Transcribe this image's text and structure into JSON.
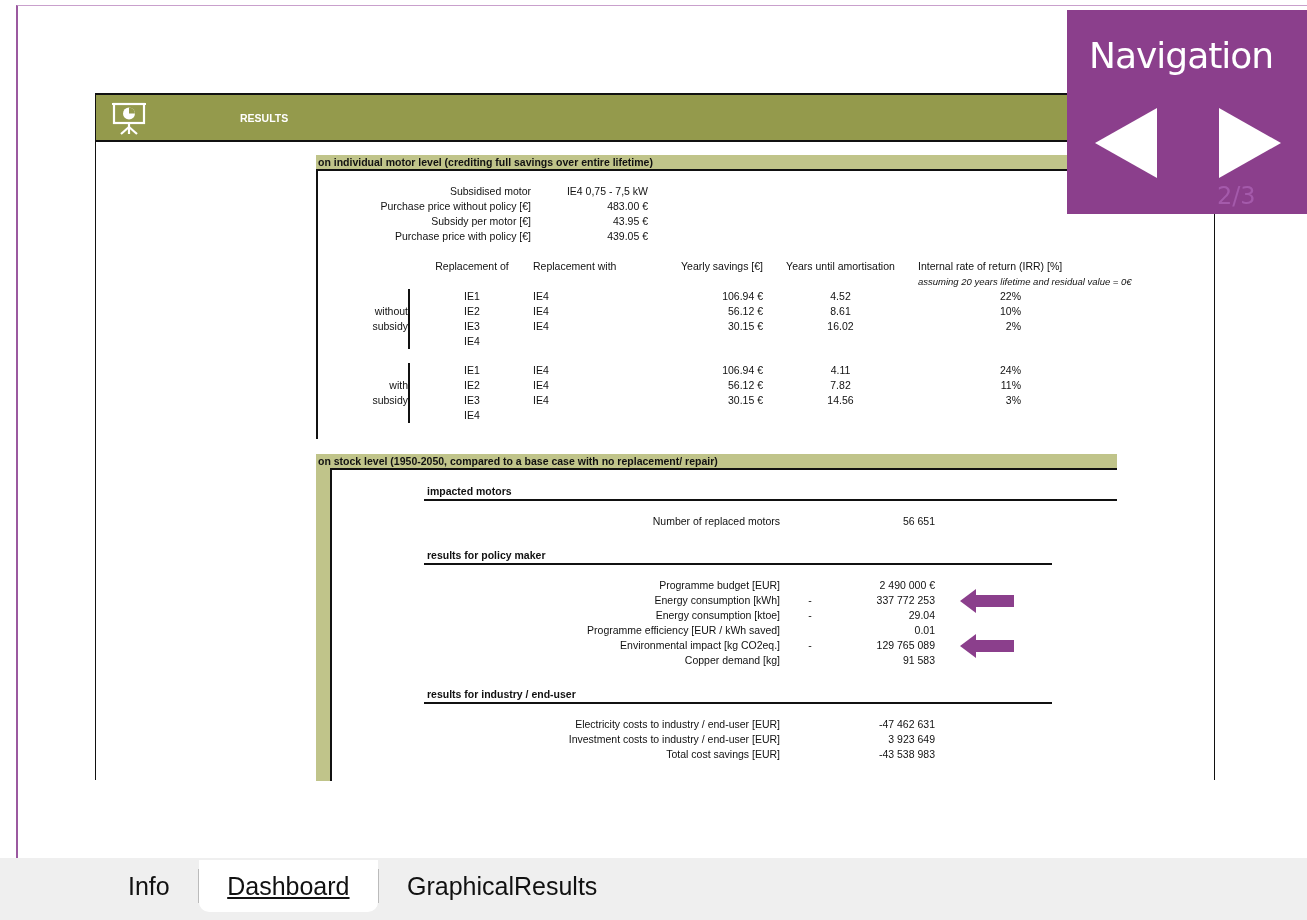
{
  "sheet_title": "RESULTS",
  "motor_section": {
    "title": "on individual motor level (crediting full savings over entire lifetime)",
    "parameters": [
      {
        "label": "Subsidised motor",
        "value": "IE4 0,75 - 7,5 kW"
      },
      {
        "label": "Purchase price without policy [€]",
        "value": "483.00 €"
      },
      {
        "label": "Subsidy per motor [€]",
        "value": "43.95 €"
      },
      {
        "label": "Purchase price with policy [€]",
        "value": "439.05 €"
      }
    ],
    "columns": [
      "Replacement of",
      "Replacement with",
      "Yearly savings [€]",
      "Years until amortisation",
      "Internal rate of return (IRR) [%]"
    ],
    "note": "assuming 20 years lifetime and residual value = 0€",
    "groups": [
      {
        "label_lines": [
          "without",
          "subsidy"
        ],
        "rows": [
          {
            "replacement_of": "IE1",
            "replacement_with": "IE4",
            "yearly_savings": "106.94 €",
            "years": "4.52",
            "irr": "22%"
          },
          {
            "replacement_of": "IE2",
            "replacement_with": "IE4",
            "yearly_savings": "56.12 €",
            "years": "8.61",
            "irr": "10%"
          },
          {
            "replacement_of": "IE3",
            "replacement_with": "IE4",
            "yearly_savings": "30.15 €",
            "years": "16.02",
            "irr": "2%"
          },
          {
            "replacement_of": "IE4"
          }
        ]
      },
      {
        "label_lines": [
          "with",
          "subsidy"
        ],
        "rows": [
          {
            "replacement_of": "IE1",
            "replacement_with": "IE4",
            "yearly_savings": "106.94 €",
            "years": "4.11",
            "irr": "24%"
          },
          {
            "replacement_of": "IE2",
            "replacement_with": "IE4",
            "yearly_savings": "56.12 €",
            "years": "7.82",
            "irr": "11%"
          },
          {
            "replacement_of": "IE3",
            "replacement_with": "IE4",
            "yearly_savings": "30.15 €",
            "years": "14.56",
            "irr": "3%"
          },
          {
            "replacement_of": "IE4"
          }
        ]
      }
    ]
  },
  "stock_section": {
    "title": "on stock level (1950-2050, compared to a base case with no replacement/ repair)",
    "blocks": [
      {
        "heading": "impacted motors",
        "rows": [
          {
            "label": "Number of replaced motors",
            "value": "56 651",
            "highlighted": false
          }
        ]
      },
      {
        "heading": "results for policy maker",
        "rows": [
          {
            "label": "Programme budget [EUR]",
            "value": "2 490 000 €",
            "highlighted": false
          },
          {
            "label": "Energy consumption [kWh]",
            "sign": "-",
            "value": "337 772 253",
            "highlighted": true
          },
          {
            "label": "Energy consumption [ktoe]",
            "sign": "-",
            "value": "29.04",
            "highlighted": false
          },
          {
            "label": "Programme efficiency [EUR / kWh saved]",
            "value": "0.01",
            "highlighted": false
          },
          {
            "label": "Environmental impact [kg CO2eq.]",
            "sign": "-",
            "value": "129 765 089",
            "highlighted": true
          },
          {
            "label": "Copper demand [kg]",
            "value": "91 583",
            "highlighted": false
          }
        ]
      },
      {
        "heading": "results for industry / end-user",
        "rows": [
          {
            "label": "Electricity costs to industry / end-user [EUR]",
            "value": "-47 462 631",
            "highlighted": false
          },
          {
            "label": "Investment costs to industry / end-user [EUR]",
            "value": "3 923 649",
            "highlighted": false
          },
          {
            "label": "Total cost savings [EUR]",
            "value": "-43 538 983",
            "highlighted": false
          }
        ]
      }
    ]
  },
  "navigation": {
    "title": "Navigation",
    "page": "2/3"
  },
  "tabs": [
    {
      "label": "Info",
      "selected": false
    },
    {
      "label": "Dashboard",
      "selected": true
    },
    {
      "label": "GraphicalResults",
      "selected": false
    }
  ]
}
